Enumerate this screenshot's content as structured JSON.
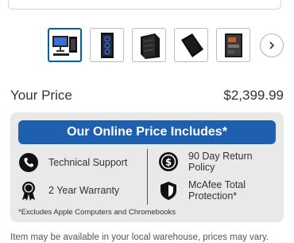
{
  "thumbnails": [
    {
      "name": "thumbnail-1",
      "active": true
    },
    {
      "name": "thumbnail-2",
      "active": false
    },
    {
      "name": "thumbnail-3",
      "active": false
    },
    {
      "name": "thumbnail-4",
      "active": false
    },
    {
      "name": "thumbnail-5",
      "active": false
    }
  ],
  "price": {
    "label": "Your Price",
    "value": "$2,399.99"
  },
  "includes": {
    "title": "Our Online Price Includes*",
    "features": [
      {
        "label": "Technical Support",
        "icon": "phone-icon"
      },
      {
        "label": "90 Day Return Policy",
        "icon": "dollar-icon"
      },
      {
        "label": "2 Year Warranty",
        "icon": "ribbon-icon"
      },
      {
        "label": "McAfee Total Protection*",
        "icon": "shield-icon"
      }
    ],
    "footnote": "*Excludes Apple Computers and Chromebooks"
  },
  "availability_note": "Item may be available in your local warehouse, prices may vary.",
  "colors": {
    "accent": "#1f5fb0",
    "card_bg": "#e9e9e9",
    "thumb_active_border": "#0060a9"
  }
}
